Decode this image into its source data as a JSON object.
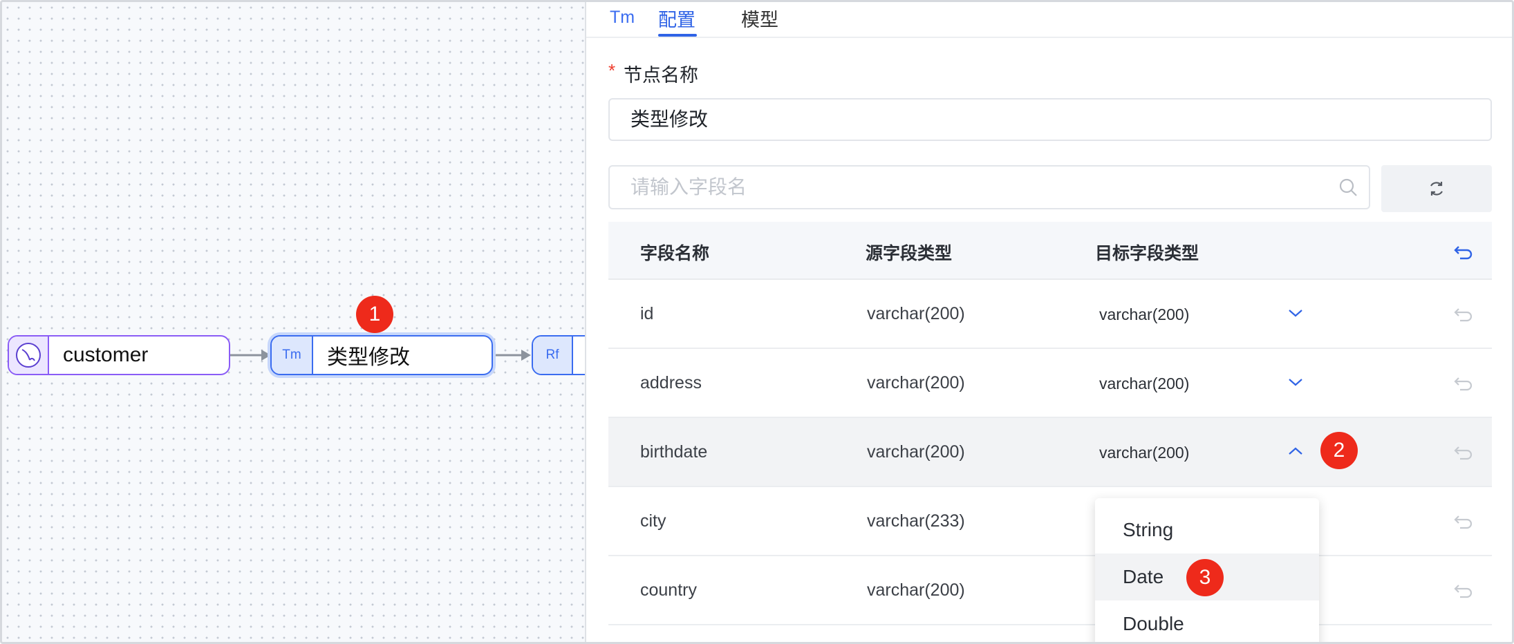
{
  "canvas": {
    "nodes": [
      {
        "label": "customer",
        "icon": "mysql-icon"
      },
      {
        "label": "类型修改",
        "icon_text": "Tm"
      },
      {
        "label": "",
        "icon_text": "Rf"
      }
    ]
  },
  "badges": [
    "1",
    "2",
    "3"
  ],
  "panel": {
    "tabs": {
      "node_type": "Tm",
      "config": "配置",
      "model": "模型"
    },
    "required_mark": "*",
    "node_name_label": "节点名称",
    "node_name_value": "类型修改",
    "search_placeholder": "请输入字段名",
    "table": {
      "headers": [
        "字段名称",
        "源字段类型",
        "目标字段类型"
      ],
      "rows": [
        {
          "name": "id",
          "source": "varchar(200)",
          "target": "varchar(200)"
        },
        {
          "name": "address",
          "source": "varchar(200)",
          "target": "varchar(200)"
        },
        {
          "name": "birthdate",
          "source": "varchar(200)",
          "target": "varchar(200)"
        },
        {
          "name": "city",
          "source": "varchar(233)",
          "target": ""
        },
        {
          "name": "country",
          "source": "varchar(200)",
          "target": ""
        }
      ]
    },
    "dropdown_options": [
      "String",
      "Date",
      "Double"
    ]
  },
  "colors": {
    "accent": "#2f63e6",
    "badge": "#ee2a1b",
    "source_node_border": "#8a5cf6"
  }
}
